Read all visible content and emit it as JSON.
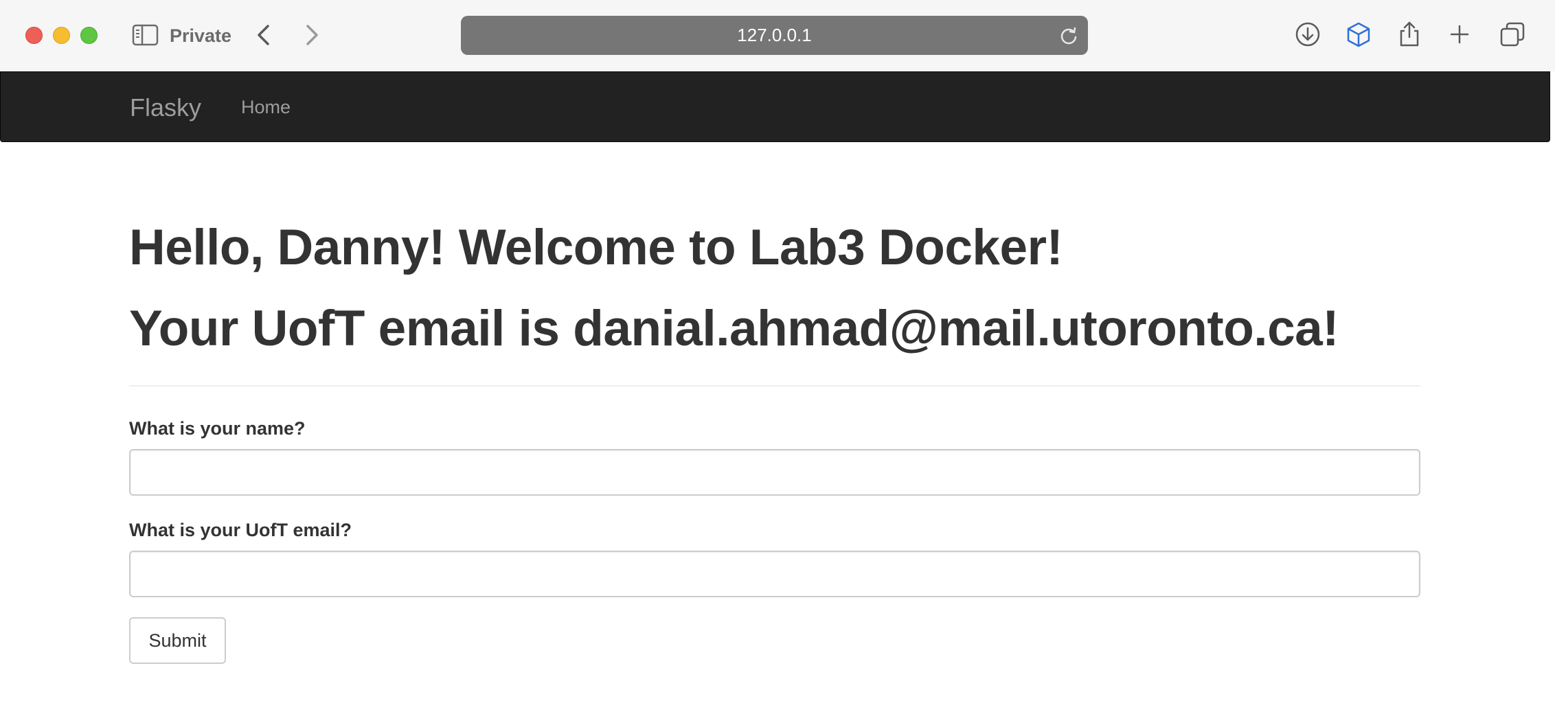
{
  "browser": {
    "mode_label": "Private",
    "address": "127.0.0.1",
    "icons": [
      "sidebar-icon",
      "back-icon",
      "forward-icon",
      "reload-icon",
      "download-icon",
      "cube-icon",
      "share-icon",
      "new-tab-icon",
      "tab-overview-icon"
    ],
    "colors": {
      "close": "#ee5f57",
      "minimize": "#f5bd2f",
      "maximize": "#5fc544",
      "address_bar": "#767676",
      "cube_accent": "#2f6fd6"
    }
  },
  "navbar": {
    "brand": "Flasky",
    "links": [
      {
        "label": "Home"
      }
    ],
    "colors": {
      "background": "#222222",
      "text": "#9d9d9d"
    }
  },
  "main": {
    "greeting_line_1": "Hello, Danny! Welcome to Lab3 Docker!",
    "greeting_line_2": "Your UofT email is danial.ahmad@mail.utoronto.ca!",
    "form": {
      "name_label": "What is your name?",
      "name_value": "",
      "email_label": "What is your UofT email?",
      "email_value": "",
      "submit_label": "Submit"
    }
  }
}
